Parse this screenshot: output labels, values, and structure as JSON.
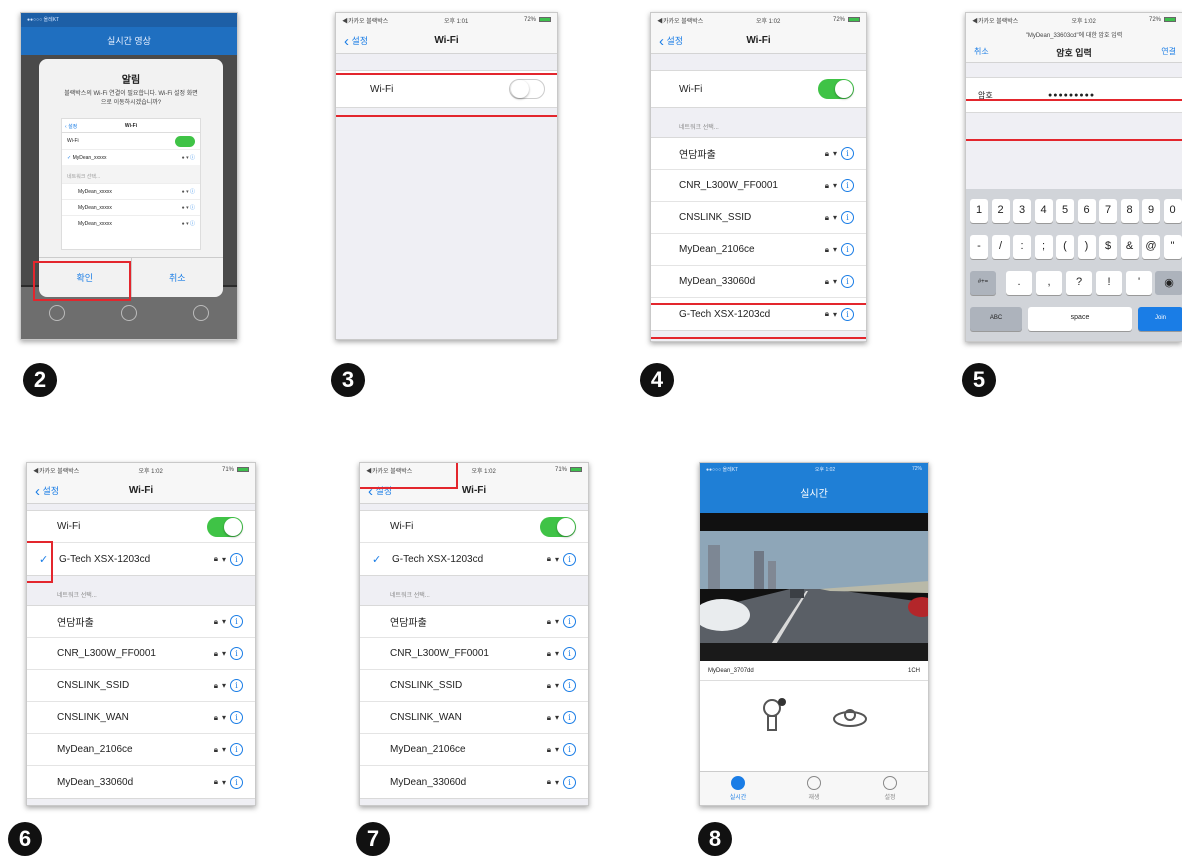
{
  "step_numbers": [
    "2",
    "3",
    "4",
    "5",
    "6",
    "7",
    "8"
  ],
  "status": {
    "carrier": "●●○○○ 올레KT",
    "carrier_alt": "◀카카오 블랙박스",
    "time": "오후 1:02",
    "time_alt": "오후 1:01",
    "battery": "72%",
    "battery_alt": "71%"
  },
  "settings": {
    "back_label": "설정",
    "wifi_title": "Wi-Fi",
    "wifi_label": "Wi-Fi",
    "choose_network": "네트워크 선택..."
  },
  "lock_icon": "lock-icon",
  "wifi_glyph": "▾",
  "info_glyph": "i",
  "phone2": {
    "header_title": "실시간 영상",
    "alert_title": "알림",
    "alert_message": "블랙박스의 Wi-Fi 연결이 필요합니다. Wi-Fi 설정 화면으로 이동하시겠습니까?",
    "mini_back": "설정",
    "mini_title": "Wi-Fi",
    "mini_wifi": "Wi-Fi",
    "mini_networks": [
      "MyDean_xxxxx",
      "MyDean_xxxxx",
      "MyDean_xxxxx",
      "MyDean_xxxxx"
    ],
    "mini_section": "네트워크 선택...",
    "confirm_label": "확인",
    "cancel_label": "취소"
  },
  "phone4": {
    "networks": [
      "연담파출",
      "CNR_L300W_FF0001",
      "CNSLINK_SSID",
      "MyDean_2106ce",
      "MyDean_33060d",
      "G-Tech XSX-1203cd"
    ]
  },
  "phone5": {
    "prompt": "\"MyDean_33603cd\"에 대한 암호 입력",
    "cancel_label": "취소",
    "title": "암호 입력",
    "join_label": "연결",
    "password_label": "암호",
    "password_value": "●●●●●●●●●",
    "keyboard_row1": [
      "1",
      "2",
      "3",
      "4",
      "5",
      "6",
      "7",
      "8",
      "9",
      "0"
    ],
    "keyboard_row2": [
      "-",
      "/",
      ":",
      ";",
      "(",
      ")",
      "$",
      "&",
      "@",
      "\""
    ],
    "keyboard_row3": [
      ".",
      ",",
      "?",
      "!",
      "'"
    ],
    "shift_key": "#+=",
    "abc_key": "ABC",
    "space_key": "space",
    "join_key": "Join"
  },
  "phone6": {
    "connected": "G-Tech XSX-1203cd",
    "networks": [
      "연담파출",
      "CNR_L300W_FF0001",
      "CNSLINK_SSID",
      "CNSLINK_WAN",
      "MyDean_2106ce",
      "MyDean_33060d"
    ]
  },
  "phone7": {
    "connected": "G-Tech XSX-1203cd",
    "networks": [
      "연담파출",
      "CNR_L300W_FF0001",
      "CNSLINK_SSID",
      "CNSLINK_WAN",
      "MyDean_2106ce",
      "MyDean_33060d"
    ]
  },
  "phone8": {
    "header_title": "실시간",
    "device_name": "MyDean_3707dd",
    "channel": "1CH",
    "tabs": [
      "실시간",
      "재생",
      "설정"
    ]
  },
  "colors": {
    "accent": "#1a7de6",
    "toggle_on": "#3fc346",
    "highlight": "#e3262d",
    "app_header": "#1f7fd6"
  }
}
